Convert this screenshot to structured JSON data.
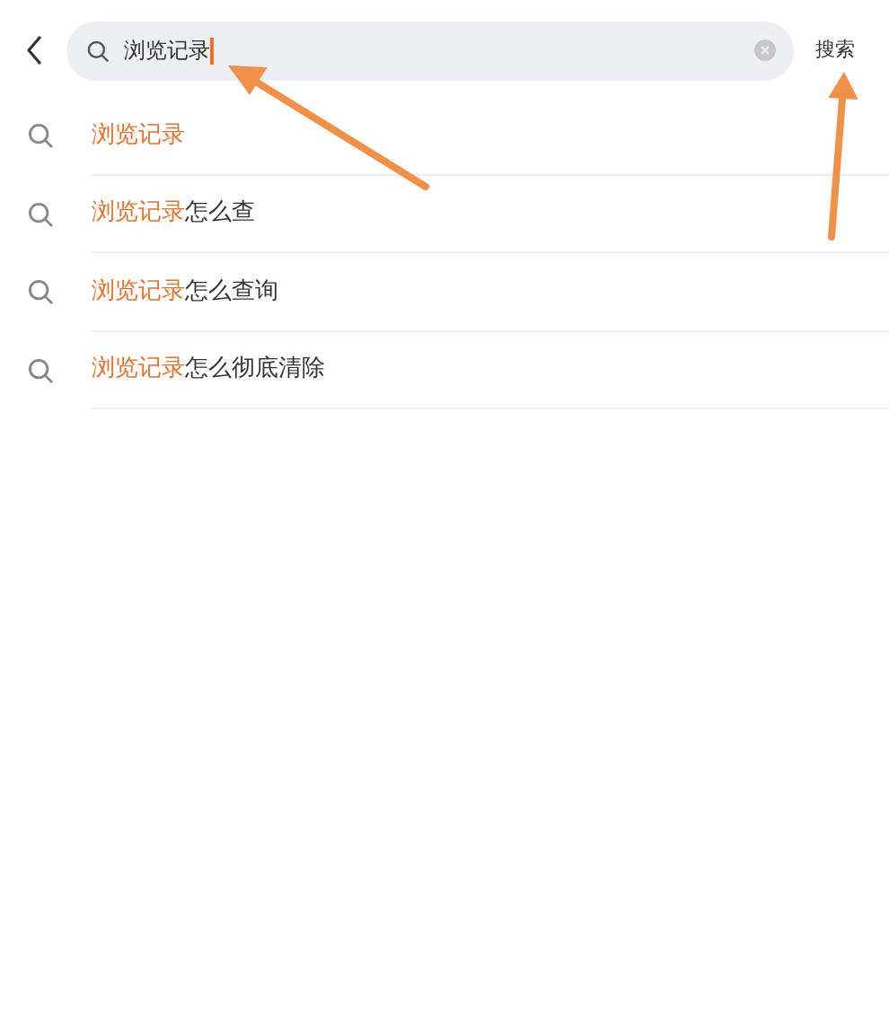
{
  "search": {
    "value": "浏览记录",
    "button": "搜索"
  },
  "suggestions": [
    {
      "match": "浏览记录"
    },
    {
      "match": "浏览记录",
      "rest": "怎么查"
    },
    {
      "match": "浏览记录",
      "rest": "怎么查询"
    },
    {
      "match": "浏览记录",
      "rest": "怎么彻底清除"
    }
  ]
}
